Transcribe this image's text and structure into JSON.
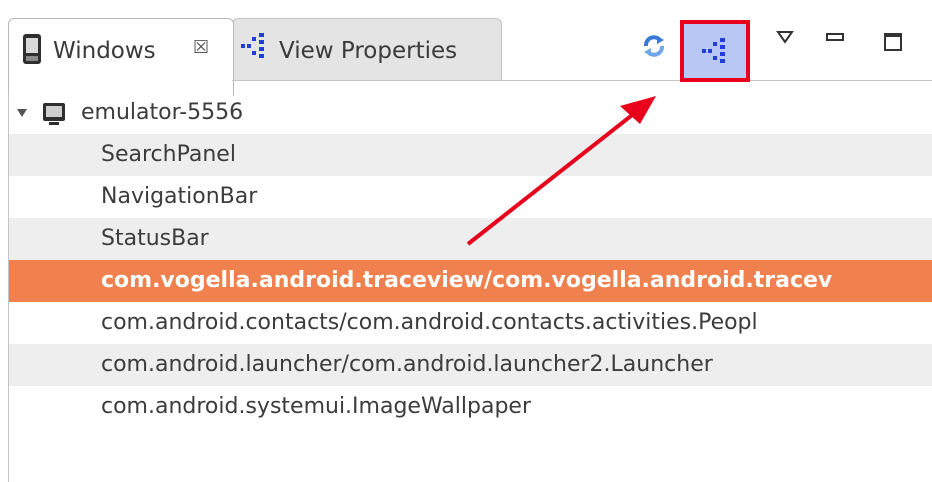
{
  "tabs": {
    "windows_label": "Windows",
    "close_symbol": "☒",
    "view_properties_label": "View Properties"
  },
  "toolbar": {
    "refresh_icon": "refresh-icon",
    "load_hierarchy_icon": "hierarchy-icon",
    "highlight_color": "#e8001c",
    "button_fill": "#b9c7f4"
  },
  "tree": {
    "root": "emulator-5556",
    "items": [
      "SearchPanel",
      "NavigationBar",
      "StatusBar",
      "com.vogella.android.traceview/com.vogella.android.tracev",
      "com.android.contacts/com.android.contacts.activities.Peopl",
      "com.android.launcher/com.android.launcher2.Launcher",
      "com.android.systemui.ImageWallpaper"
    ],
    "selected_index": 3,
    "selected_color": "#f0804d"
  }
}
